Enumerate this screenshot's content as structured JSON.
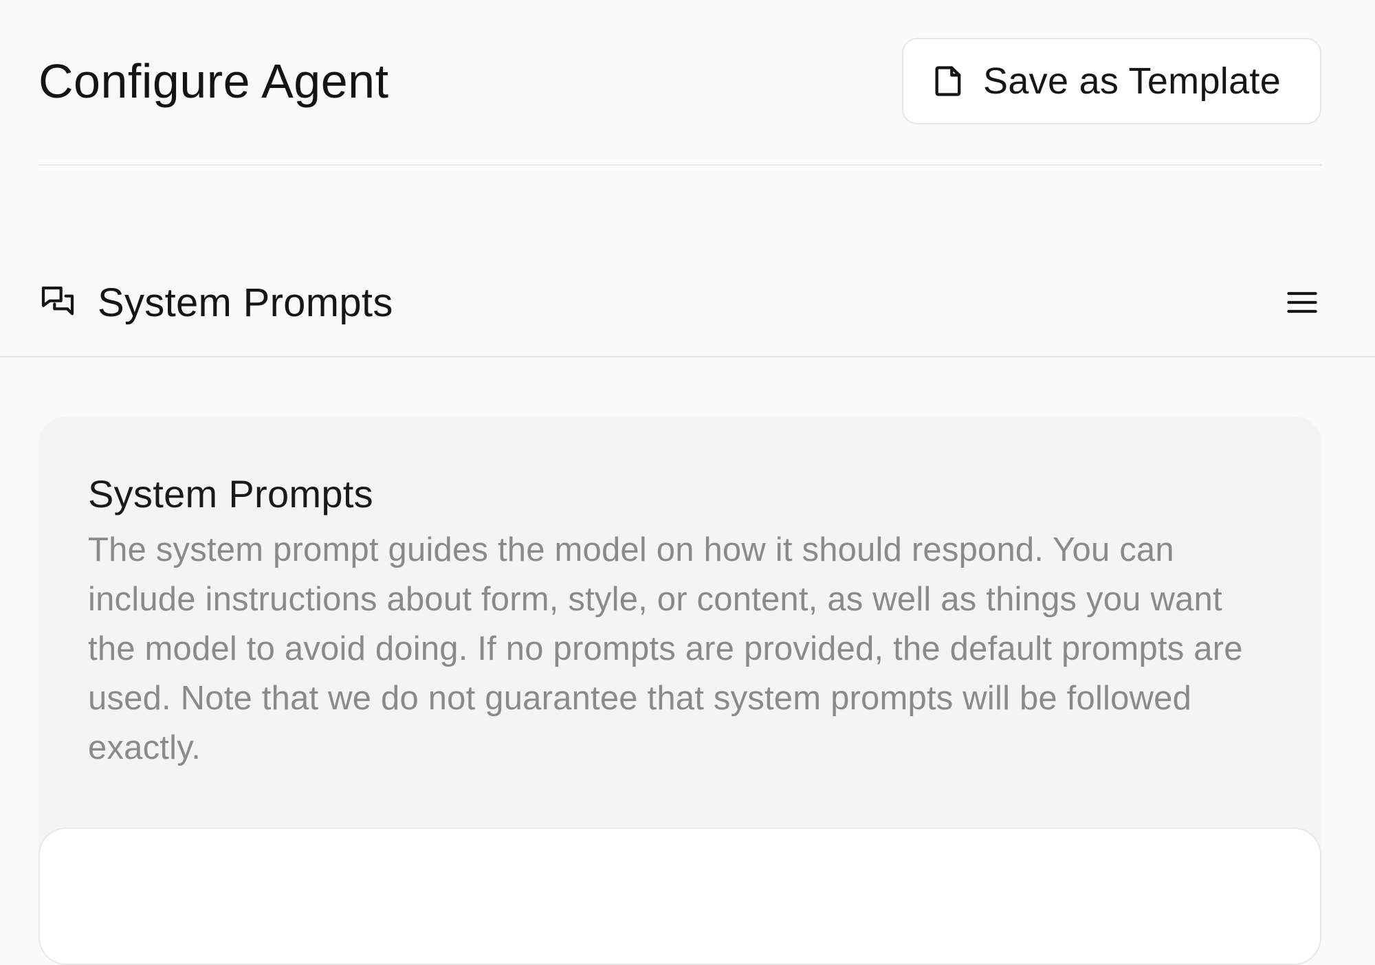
{
  "header": {
    "title": "Configure Agent",
    "save_template_label": "Save as Template",
    "save_template_icon": "document-icon"
  },
  "section": {
    "icon": "chat-bubbles-icon",
    "title": "System Prompts",
    "menu_icon": "hamburger-menu-icon"
  },
  "card": {
    "title": "System Prompts",
    "description": "The system prompt guides the model on how it should respond. You can include instructions about form, style, or content, as well as things you want the model to avoid doing. If no prompts are provided, the default prompts are used. Note that we do not guarantee that system prompts will be followed exactly."
  }
}
